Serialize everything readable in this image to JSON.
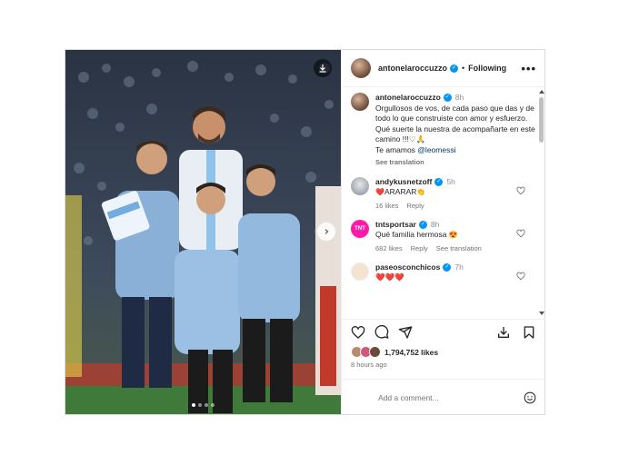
{
  "post": {
    "author": "antonelaroccuzzo",
    "follow_label": "Following",
    "separator": "•",
    "more_label": "•••"
  },
  "caption": {
    "author": "antonelaroccuzzo",
    "time": "8h",
    "lines": [
      "Orgullosos de vos, de cada paso que das y de todo lo que construiste  con amor y esfuerzo.",
      "Qué suerte la nuestra de acompañarte en este camino !!!♡🙏",
      "Te amamos "
    ],
    "mention": "@leomessi",
    "see_translation": "See translation"
  },
  "comments": [
    {
      "user": "andykusnetzoff",
      "time": "5h",
      "text": "ARARAR",
      "emojis_before": "❤️",
      "emojis_after": "👏",
      "likes": "16 likes",
      "reply": "Reply"
    },
    {
      "user": "tntsportsar",
      "time": "8h",
      "text": "Qué familia hermosa ",
      "emojis_after": "😍",
      "likes": "682 likes",
      "reply": "Reply",
      "see_translation": "See translation",
      "avatar_text": "TNT SPORTS"
    },
    {
      "user": "paseosconchicos",
      "time": "7h",
      "text": "❤️❤️❤️"
    }
  ],
  "like_count": "1,794,752 likes",
  "time_ago": "8 hours ago",
  "add_comment_placeholder": "Add a comment...",
  "colors": {
    "verified": "#0095f6",
    "accent_pink": "#ff1aa8"
  },
  "icons": [
    "download-icon",
    "chevron-right-icon",
    "heart-icon",
    "comment-icon",
    "share-icon",
    "save-icon",
    "bookmark-icon",
    "smile-icon",
    "more-icon"
  ]
}
